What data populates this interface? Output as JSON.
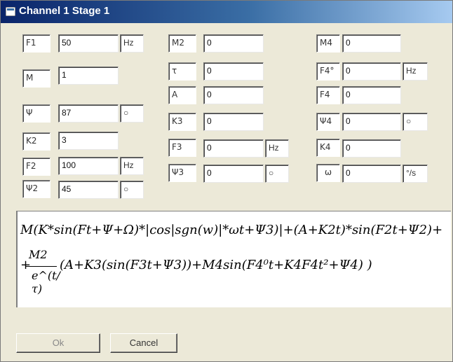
{
  "window": {
    "title": "Channel 1 Stage 1"
  },
  "params": {
    "F1": {
      "label": "F1",
      "value": "50",
      "unit": "Hz"
    },
    "M": {
      "label": "M",
      "value": "1"
    },
    "Psi": {
      "label": "Ψ",
      "value": "87",
      "unit": "○"
    },
    "K2": {
      "label": "K2",
      "value": "3"
    },
    "F2": {
      "label": "F2",
      "value": "100",
      "unit": "Hz"
    },
    "Psi2": {
      "label": "Ψ2",
      "value": "45",
      "unit": "○"
    },
    "M2": {
      "label": "M2",
      "value": "0"
    },
    "tau": {
      "label": "τ",
      "value": "0"
    },
    "A": {
      "label": "A",
      "value": "0"
    },
    "K3": {
      "label": "K3",
      "value": "0"
    },
    "F3": {
      "label": "F3",
      "value": "0",
      "unit": "Hz"
    },
    "Psi3": {
      "label": "Ψ3",
      "value": "0",
      "unit": "○"
    },
    "M4": {
      "label": "M4",
      "value": "0"
    },
    "F4_0": {
      "label": "F4°",
      "value": "0",
      "unit": "Hz"
    },
    "F4": {
      "label": "F4",
      "value": "0"
    },
    "Psi4": {
      "label": "Ψ4",
      "value": "0",
      "unit": "○"
    },
    "K4": {
      "label": "K4",
      "value": "0"
    },
    "omega": {
      "label": "ω",
      "value": "0",
      "unit": "°/s"
    }
  },
  "formula": {
    "line1": "M(K*sin(Ft+Ψ+Ω)*|cos|sgn(w)|*ωt+Ψ3)|+(A+K2t)*sin(F2t+Ψ2)+",
    "plus": "+",
    "frac_num": "M2",
    "frac_den": "e^(t/τ)",
    "line2": "(A+K3(sin(F3t+Ψ3))+M4sin(F4⁰t+K4F4t²+Ψ4) )"
  },
  "buttons": {
    "ok": "Ok",
    "cancel": "Cancel"
  }
}
